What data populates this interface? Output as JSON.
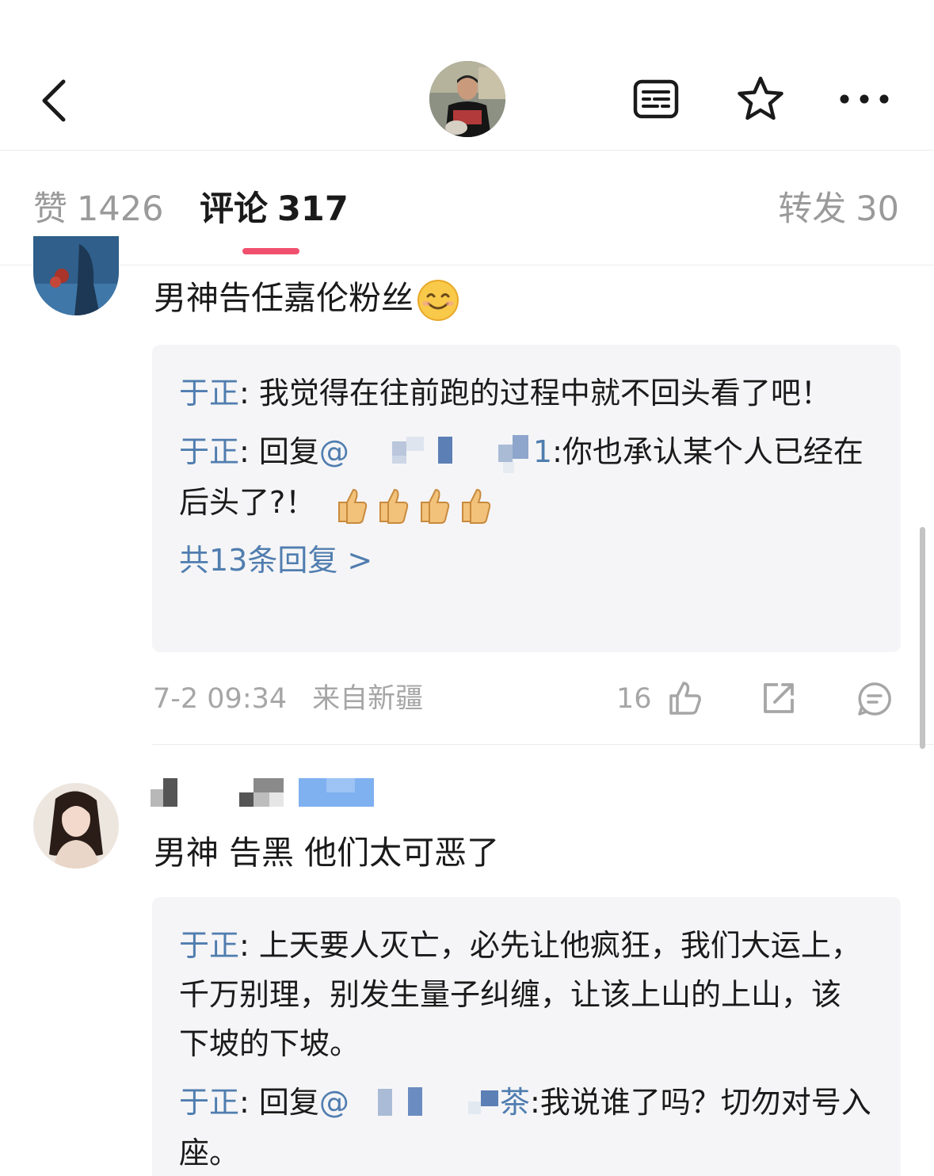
{
  "header": {
    "back_icon": "chevron-left-icon",
    "avatar_icon": "user-avatar",
    "actions": [
      "article-icon",
      "star-icon",
      "more-icon"
    ]
  },
  "tabs": {
    "like": {
      "label": "赞",
      "count": "1426"
    },
    "comment": {
      "label": "评论",
      "count": "317"
    },
    "repost": {
      "label": "转发",
      "count": "30"
    },
    "indicator_color": "#f0506e"
  },
  "comments": [
    {
      "text": "男神告任嘉伦粉丝",
      "text_emoji": "smile-emoji",
      "replies": [
        {
          "author": "于正",
          "sep": ":",
          "text": " 我觉得在往前跑的过程中就不回头看了吧！"
        },
        {
          "author": "于正",
          "sep": ":",
          "prefix": " 回复",
          "mention_start": "@",
          "mention_end": "1",
          "text": ":你也承认某个人已经在后头了?！",
          "emoji": "thumbs-up-emoji"
        }
      ],
      "more_replies": "共13条回复 >",
      "time": "7-2 09:34",
      "location": "来自新疆",
      "like_count": "16"
    },
    {
      "text": "男神 告黑 他们太可恶了",
      "replies": [
        {
          "author": "于正",
          "sep": ":",
          "text": " 上天要人灭亡，必先让他疯狂，我们大运上，千万别理，别发生量子纠缠，让该上山的上山，该下坡的下坡。"
        },
        {
          "author": "于正",
          "sep": ":",
          "prefix": " 回复",
          "mention_start": "@",
          "mention_end": "茶",
          "text": ":我说谁了吗？切勿对号入座。"
        }
      ]
    }
  ],
  "colors": {
    "link": "#507daf",
    "meta": "#a6a6a6",
    "reply_bg": "#f5f5f7"
  }
}
